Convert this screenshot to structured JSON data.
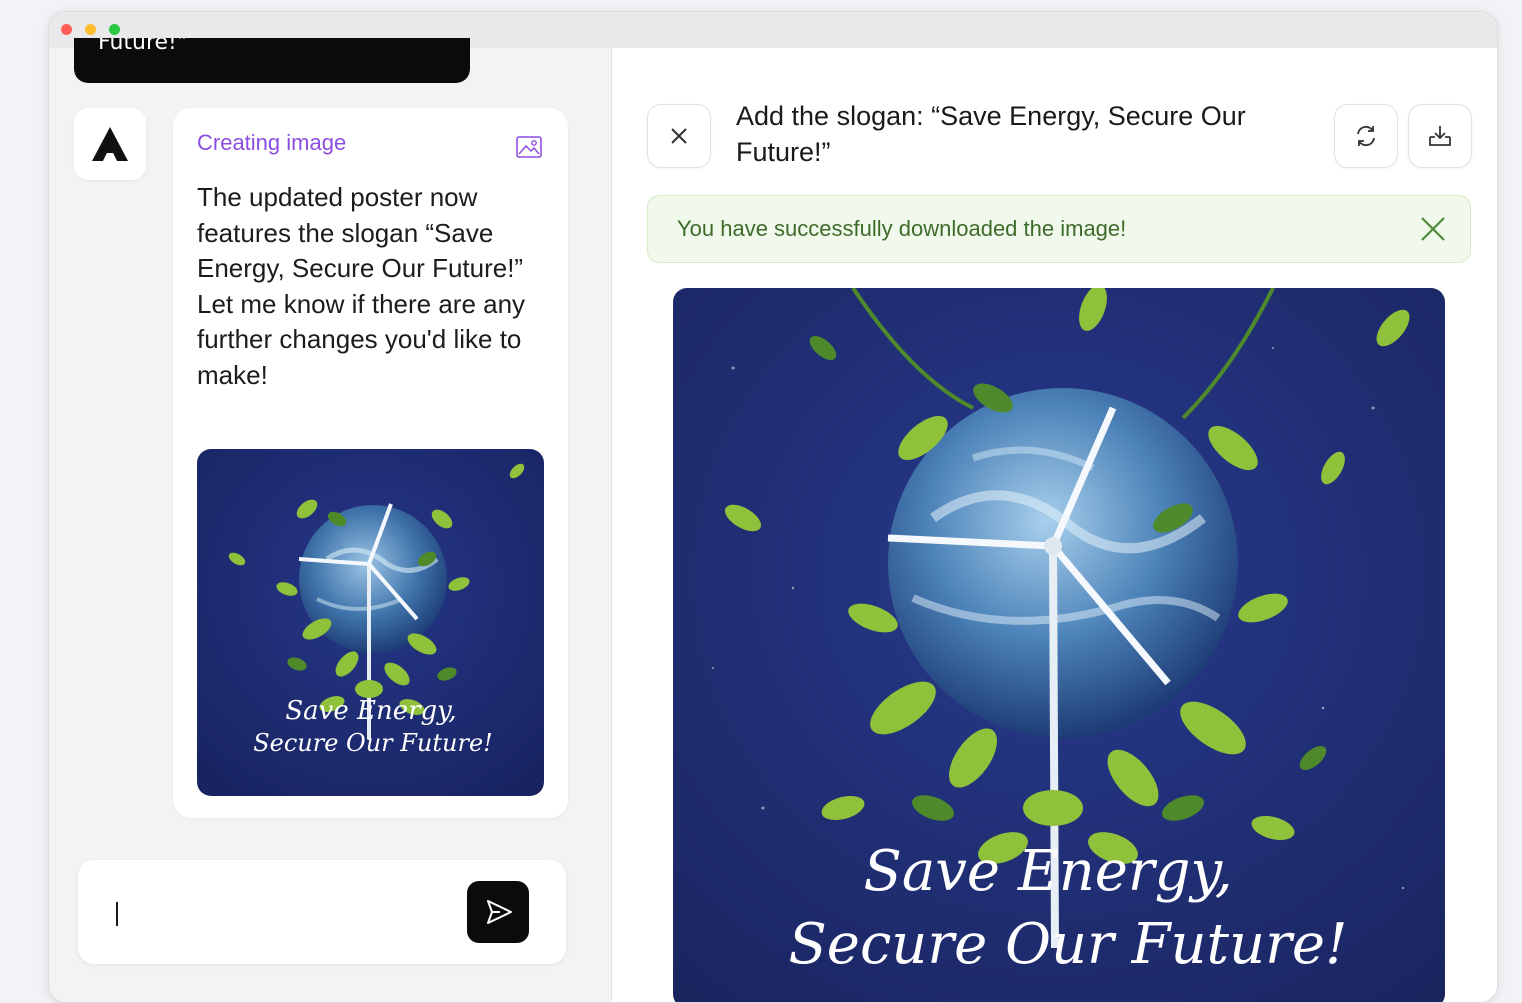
{
  "window": {
    "controls": [
      "close",
      "minimize",
      "maximize"
    ]
  },
  "chat": {
    "previous_bubble_text": "Future!\"",
    "assistant_avatar": "assistant-logo",
    "message": {
      "status_label": "Creating image",
      "status_icon": "image-icon",
      "body": "The updated poster now features the slogan “Save Energy, Secure Our Future!” Let me know if there are any further changes you'd like to make!",
      "thumbnail_caption_line1": "Save Energy,",
      "thumbnail_caption_line2": "Secure Our Future!"
    },
    "composer": {
      "value": "",
      "send_icon": "send-icon"
    }
  },
  "preview": {
    "title": "Add the slogan: “Save Energy, Secure Our Future!”",
    "close_icon": "close-icon",
    "regenerate_icon": "refresh-icon",
    "download_icon": "download-icon",
    "toast": {
      "message": "You have successfully downloaded the image!",
      "close_icon": "close-icon"
    },
    "image_caption_line1": "Save Energy,",
    "image_caption_line2": "Secure Our Future!"
  },
  "colors": {
    "accent_purple": "#8b4fe0",
    "toast_bg": "#f0f9ec",
    "toast_text": "#3f6b2a",
    "poster_bg": "#1c2a6b",
    "leaf_green": "#8fc23a"
  }
}
